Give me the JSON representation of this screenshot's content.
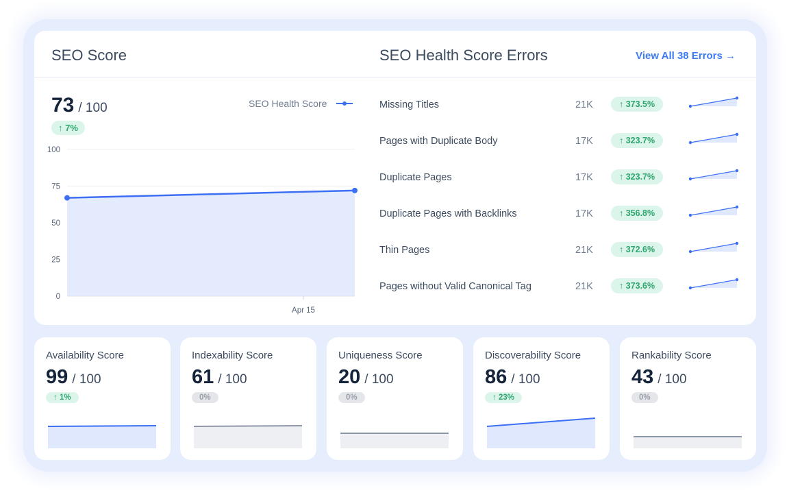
{
  "seo_score": {
    "title": "SEO Score",
    "value": "73",
    "max": "/ 100",
    "change": "↑ 7%",
    "legend": "SEO Health Score",
    "accent": "#3d6ff5"
  },
  "chart_data": {
    "type": "area",
    "series": [
      {
        "name": "SEO Health Score",
        "values": [
          67,
          72
        ]
      }
    ],
    "x_tick_labels": [
      "Apr 15"
    ],
    "y_ticks": [
      "100",
      "75",
      "50",
      "25",
      "0"
    ],
    "ylim": [
      0,
      100
    ],
    "grid": true
  },
  "errors": {
    "title": "SEO Health Score Errors",
    "view_all": "View All 38 Errors →",
    "items": [
      {
        "label": "Missing Titles",
        "count": "21K",
        "change": "↑ 373.5%"
      },
      {
        "label": "Pages with Duplicate Body",
        "count": "17K",
        "change": "↑ 323.7%"
      },
      {
        "label": "Duplicate Pages",
        "count": "17K",
        "change": "↑ 323.7%"
      },
      {
        "label": "Duplicate Pages with Backlinks",
        "count": "17K",
        "change": "↑ 356.8%"
      },
      {
        "label": "Thin Pages",
        "count": "21K",
        "change": "↑ 372.6%"
      },
      {
        "label": "Pages without Valid Canonical Tag",
        "count": "21K",
        "change": "↑ 373.6%"
      }
    ]
  },
  "scores": [
    {
      "title": "Availability Score",
      "value": "99",
      "max": "/ 100",
      "change": "↑ 1%",
      "trend": "up"
    },
    {
      "title": "Indexability Score",
      "value": "61",
      "max": "/ 100",
      "change": "0%",
      "trend": "flat"
    },
    {
      "title": "Uniqueness Score",
      "value": "20",
      "max": "/ 100",
      "change": "0%",
      "trend": "flat"
    },
    {
      "title": "Discoverability Score",
      "value": "86",
      "max": "/ 100",
      "change": "↑ 23%",
      "trend": "up"
    },
    {
      "title": "Rankability Score",
      "value": "43",
      "max": "/ 100",
      "change": "0%",
      "trend": "flat"
    }
  ]
}
